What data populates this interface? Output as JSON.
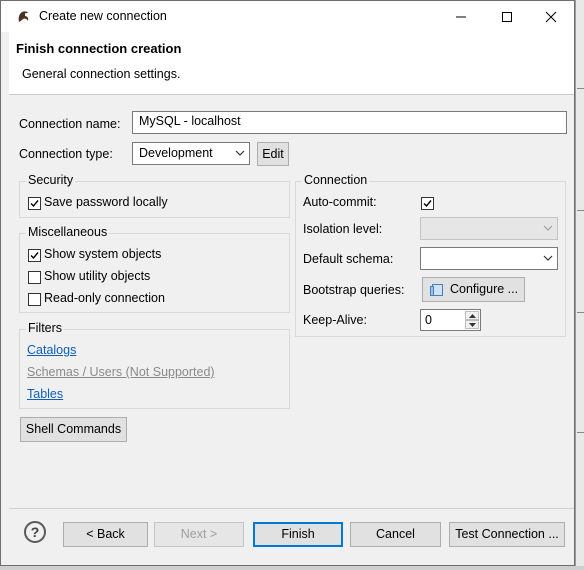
{
  "window": {
    "title": "Create new connection"
  },
  "header": {
    "title": "Finish connection creation",
    "subtitle": "General connection settings."
  },
  "form": {
    "connection_name_label": "Connection name:",
    "connection_name_value": "MySQL - localhost",
    "connection_type_label": "Connection type:",
    "connection_type_value": "Development",
    "edit_button": "Edit"
  },
  "security": {
    "title": "Security",
    "save_password_label": "Save password locally",
    "save_password_checked": true
  },
  "misc": {
    "title": "Miscellaneous",
    "items": [
      {
        "label": "Show system objects",
        "checked": true
      },
      {
        "label": "Show utility objects",
        "checked": false
      },
      {
        "label": "Read-only connection",
        "checked": false
      }
    ]
  },
  "filters": {
    "title": "Filters",
    "catalogs": "Catalogs",
    "schemas": "Schemas / Users (Not Supported)",
    "tables": "Tables"
  },
  "shell_commands_button": "Shell Commands",
  "connection": {
    "title": "Connection",
    "auto_commit_label": "Auto-commit:",
    "auto_commit_checked": true,
    "isolation_label": "Isolation level:",
    "isolation_value": "",
    "default_schema_label": "Default schema:",
    "default_schema_value": "",
    "bootstrap_label": "Bootstrap queries:",
    "configure_button": "Configure ...",
    "keepalive_label": "Keep-Alive:",
    "keepalive_value": "0"
  },
  "footer": {
    "help_glyph": "?",
    "back": "< Back",
    "next": "Next >",
    "finish": "Finish",
    "cancel": "Cancel",
    "test": "Test Connection ..."
  },
  "colors": {
    "accent": "#0078d7",
    "link": "#0e5eb9"
  }
}
